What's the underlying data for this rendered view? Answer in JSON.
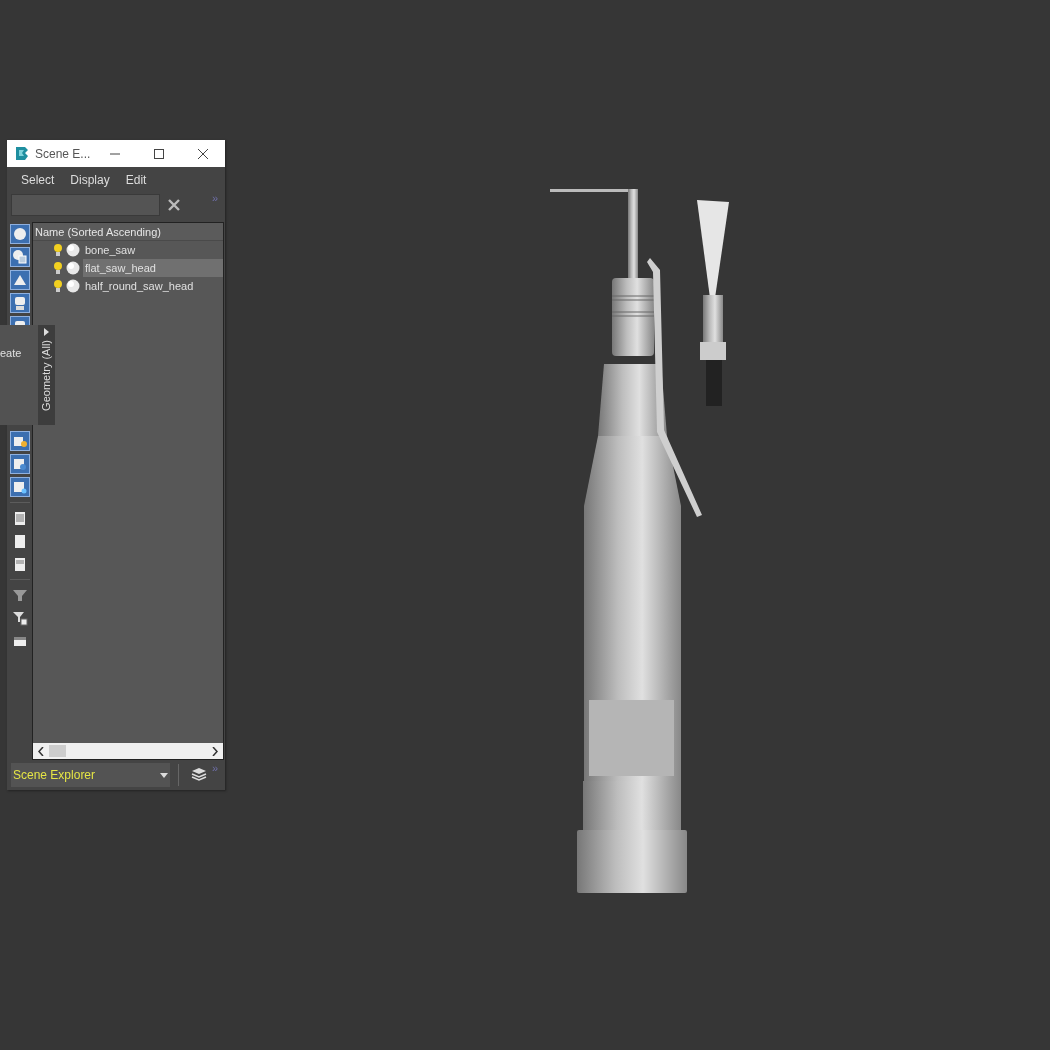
{
  "window": {
    "title": "Scene E..."
  },
  "menu": [
    "Select",
    "Display",
    "Edit"
  ],
  "expand_chevrons": [
    "»",
    "»"
  ],
  "toolbar": [
    {
      "on": true
    },
    {
      "on": true
    },
    {
      "on": true
    },
    {
      "on": true
    },
    {
      "on": true
    },
    {
      "kind": "hidden"
    },
    {
      "kind": "hidden"
    },
    {
      "kind": "hidden"
    },
    {
      "kind": "hidden"
    },
    {
      "on": true
    },
    {
      "on": true
    },
    {
      "on": true
    },
    {
      "kind": "sep"
    },
    {
      "on": false
    },
    {
      "on": false
    },
    {
      "on": false
    },
    {
      "kind": "sep"
    },
    {
      "on": false
    },
    {
      "on": false
    },
    {
      "on": false
    }
  ],
  "table": {
    "columns": [
      "Name (Sorted Ascending)"
    ],
    "rows": [
      {
        "name": "bone_saw",
        "selected": false
      },
      {
        "name": "flat_saw_head",
        "selected": true
      },
      {
        "name": "half_round_saw_head",
        "selected": false
      }
    ]
  },
  "flyout": {
    "label": "eate",
    "tab": "Geometry (All)"
  },
  "explorer_selector": {
    "value": "Scene Explorer"
  }
}
